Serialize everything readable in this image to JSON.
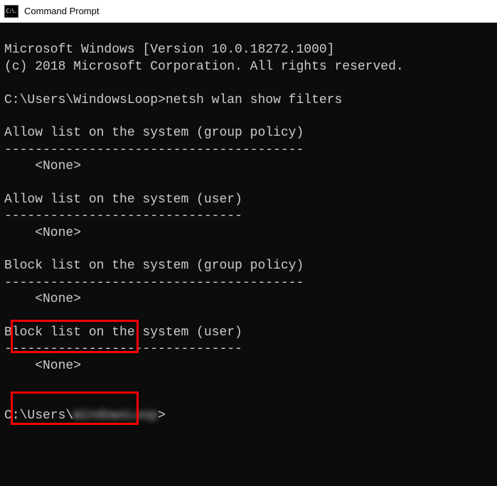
{
  "window": {
    "icon_label": "C:\\.",
    "title": "Command Prompt"
  },
  "terminal": {
    "header1": "Microsoft Windows [Version 10.0.18272.1000]",
    "header2": "(c) 2018 Microsoft Corporation. All rights reserved.",
    "prompt1_path": "C:\\Users\\WindowsLoop>",
    "prompt1_command": "netsh wlan show filters",
    "section_allow_gp_title": "Allow list on the system (group policy)",
    "section_allow_gp_divider": "---------------------------------------",
    "section_allow_gp_content": "    <None>",
    "section_allow_user_title": "Allow list on the system (user)",
    "section_allow_user_divider": "-------------------------------",
    "section_allow_user_content": "    <None>",
    "section_block_gp_title": "Block list on the system (group policy)",
    "section_block_gp_divider": "---------------------------------------",
    "section_block_gp_content": "    <None>",
    "section_block_user_title": "Block list on the system (user)",
    "section_block_user_divider": "-------------------------------",
    "section_block_user_content": "    <None>",
    "prompt2_path": "C:\\Users\\",
    "prompt2_user_hidden": "WindowsLoop",
    "prompt2_end": ">"
  }
}
